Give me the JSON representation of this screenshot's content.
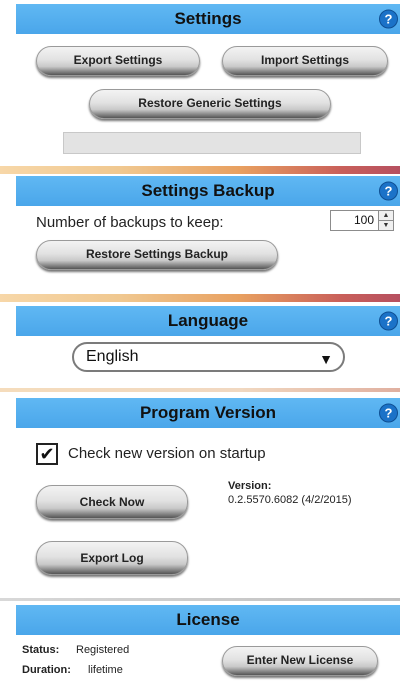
{
  "settings": {
    "title": "Settings",
    "export_label": "Export Settings",
    "import_label": "Import Settings",
    "restore_generic_label": "Restore Generic Settings"
  },
  "backup": {
    "title": "Settings Backup",
    "count_label": "Number of backups to keep:",
    "count_value": "100",
    "restore_label": "Restore Settings Backup"
  },
  "language": {
    "title": "Language",
    "selected": "English"
  },
  "version": {
    "title": "Program Version",
    "check_on_startup_label": "Check new version on startup",
    "check_on_startup": true,
    "check_now_label": "Check Now",
    "version_heading": "Version:",
    "version_value": "0.2.5570.6082 (4/2/2015)",
    "export_log_label": "Export Log"
  },
  "license": {
    "title": "License",
    "status_label": "Status:",
    "status_value": "Registered",
    "duration_label": "Duration:",
    "duration_value": "lifetime",
    "enter_new_label": "Enter New License"
  },
  "help_glyph": "?",
  "colors": {
    "header_blue": "#4aa6ea",
    "help_blue": "#1b72c8"
  }
}
